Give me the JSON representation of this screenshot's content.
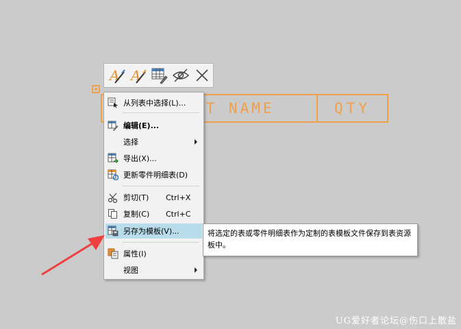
{
  "table": {
    "name_header": "RT NAME",
    "qty_header": "QTY",
    "line_color": "#f0a04a"
  },
  "toolbar": {
    "buttons": [
      {
        "icon": "text-style-icon"
      },
      {
        "icon": "text-style-alt-icon"
      },
      {
        "icon": "table-settings-icon"
      },
      {
        "icon": "hide-icon"
      },
      {
        "icon": "close-icon"
      }
    ]
  },
  "menu": {
    "select_from_list": "从列表中选择(L)...",
    "edit": "编辑(E)...",
    "select": "选择",
    "export": "导出(X)...",
    "update_parts_list": "更新零件明细表(D)",
    "cut": "剪切(T)",
    "cut_shortcut": "Ctrl+X",
    "copy": "复制(C)",
    "copy_shortcut": "Ctrl+C",
    "save_as_template": "另存为模板(V)...",
    "properties": "属性(I)",
    "view": "视图",
    "highlight_color": "#b9dcea"
  },
  "tooltip": {
    "text": "将选定的表或零件明细表作为定制的表模板文件保存到表资源板中。"
  },
  "annotation": {
    "arrow_color": "#ef3f3f"
  },
  "watermark": {
    "text": "UG爱好者论坛@伤口上散盐"
  }
}
